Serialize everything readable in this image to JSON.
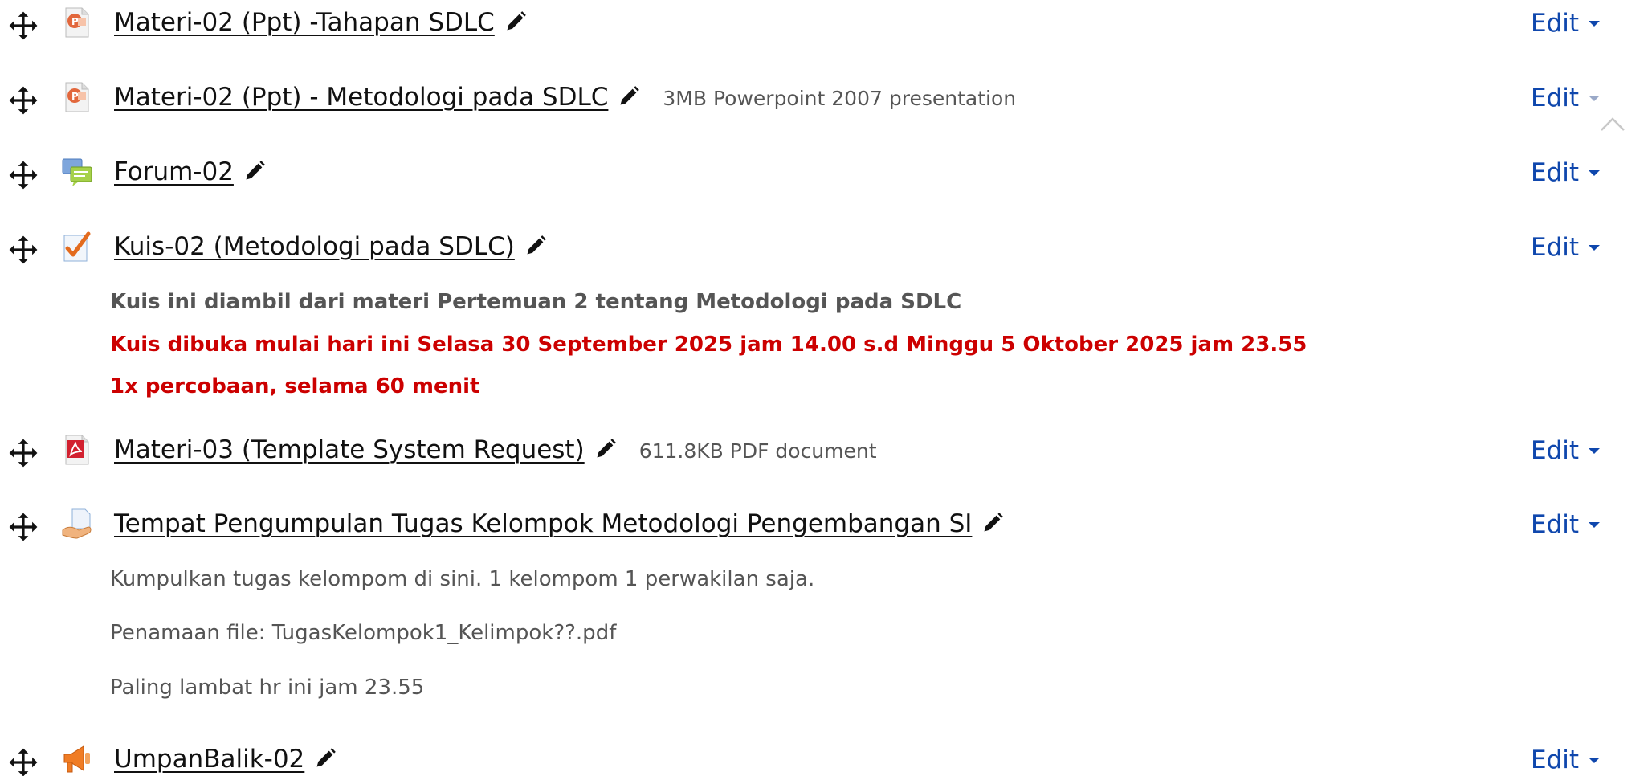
{
  "activities": [
    {
      "title": "Materi-02 (Ppt) -Tahapan SDLC",
      "icon": "powerpoint-icon",
      "meta": "",
      "edit_label": "Edit"
    },
    {
      "title": "Materi-02 (Ppt) - Metodologi pada SDLC",
      "icon": "powerpoint-icon",
      "meta": "3MB Powerpoint 2007 presentation",
      "edit_label": "Edit"
    },
    {
      "title": "Forum-02",
      "icon": "forum-icon",
      "meta": "",
      "edit_label": "Edit"
    },
    {
      "title": "Kuis-02 (Metodologi pada SDLC)",
      "icon": "quiz-icon",
      "meta": "",
      "edit_label": "Edit",
      "description": [
        "Kuis ini diambil dari materi Pertemuan 2 tentang Metodologi pada SDLC",
        "Kuis dibuka mulai hari ini Selasa 30 September 2025  jam 14.00 s.d  Minggu 5 Oktober 2025 jam 23.55",
        "1x percobaan, selama 60 menit"
      ]
    },
    {
      "title": "Materi-03 (Template System Request)",
      "icon": "pdf-icon",
      "meta": "611.8KB PDF document",
      "edit_label": "Edit"
    },
    {
      "title": "Tempat Pengumpulan Tugas Kelompok Metodologi Pengembangan SI",
      "icon": "assignment-icon",
      "meta": "",
      "edit_label": "Edit",
      "description": [
        "Kumpulkan tugas kelompom di sini. 1 kelompom 1 perwakilan saja.",
        "Penamaan file: TugasKelompok1_Kelimpok??.pdf",
        "Paling lambat hr ini jam 23.55"
      ]
    },
    {
      "title": "UmpanBalik-02",
      "icon": "feedback-icon",
      "meta": "",
      "edit_label": "Edit"
    }
  ],
  "colors": {
    "link": "#111111",
    "edit": "#0f47ad",
    "description_grey": "#555555",
    "description_red": "#cc0000"
  }
}
